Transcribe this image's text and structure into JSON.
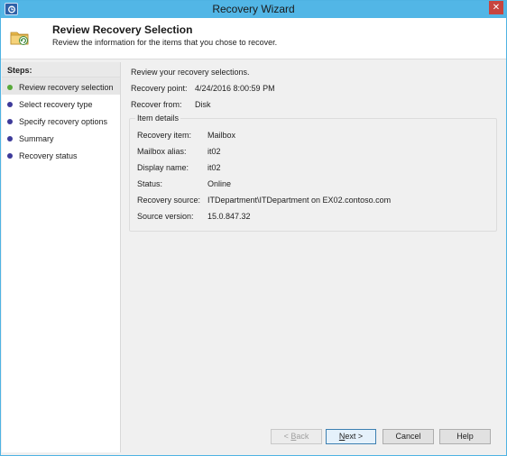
{
  "window": {
    "title": "Recovery Wizard",
    "close_glyph": "✕"
  },
  "header": {
    "title": "Review Recovery Selection",
    "subtitle": "Review the information for the items that you chose to recover.",
    "icon": "folder-recovery-icon"
  },
  "steps": {
    "label": "Steps:",
    "items": [
      {
        "label": "Review recovery selection",
        "state": "done",
        "active": true
      },
      {
        "label": "Select recovery type",
        "state": "pending",
        "active": false
      },
      {
        "label": "Specify recovery options",
        "state": "pending",
        "active": false
      },
      {
        "label": "Summary",
        "state": "pending",
        "active": false
      },
      {
        "label": "Recovery status",
        "state": "pending",
        "active": false
      }
    ]
  },
  "main": {
    "intro": "Review your recovery selections.",
    "recovery_point_label": "Recovery point:",
    "recovery_point_value": "4/24/2016 8:00:59 PM",
    "recover_from_label": "Recover from:",
    "recover_from_value": "Disk",
    "item_details": {
      "legend": "Item details",
      "rows": [
        {
          "label": "Recovery item:",
          "value": "Mailbox"
        },
        {
          "label": "Mailbox alias:",
          "value": "it02"
        },
        {
          "label": "Display name:",
          "value": "it02"
        },
        {
          "label": "Status:",
          "value": "Online"
        },
        {
          "label": "Recovery source:",
          "value": "ITDepartment\\ITDepartment on EX02.contoso.com"
        },
        {
          "label": "Source version:",
          "value": "15.0.847.32"
        }
      ]
    }
  },
  "buttons": {
    "back_prefix": "< ",
    "back_key": "B",
    "back_rest": "ack",
    "next_key": "N",
    "next_rest": "ext >",
    "cancel": "Cancel",
    "help": "Help"
  },
  "colors": {
    "titlebar": "#52b6e6",
    "step_done": "#58a93a",
    "step_pending": "#3d3a9a"
  }
}
